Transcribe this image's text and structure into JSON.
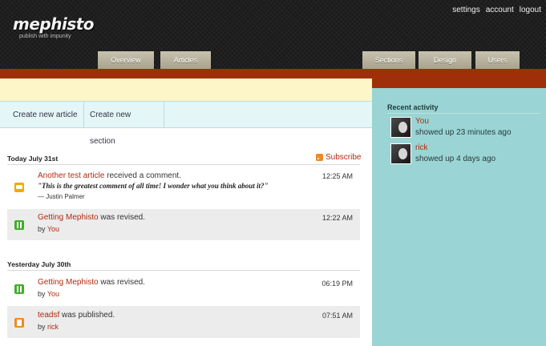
{
  "logo": {
    "name": "mephisto",
    "tagline": "publish with impunity"
  },
  "toplinks": [
    "settings",
    "account",
    "logout"
  ],
  "tabs": {
    "overview": "Overview",
    "articles": "Articles",
    "sections": "Sections",
    "design": "Design",
    "users": "Users"
  },
  "actions": {
    "new_article": "Create new article",
    "new_section": "Create new section"
  },
  "subscribe": "Subscribe",
  "days": [
    {
      "title": "Today July 31st",
      "entries": [
        {
          "icon": "comment-icon",
          "link": "Another test article",
          "text": " received a comment.",
          "quote": "\"This is the greatest comment of all time! I wonder what you think about it?\"",
          "author": "— Justin Palmer",
          "time": "12:25 AM"
        },
        {
          "icon": "revision-icon",
          "link": "Getting Mephisto",
          "text": " was revised.",
          "by": "by ",
          "by_user": "You",
          "time": "12:22 AM"
        }
      ]
    },
    {
      "title": "Yesterday July 30th",
      "entries": [
        {
          "icon": "revision-icon",
          "link": "Getting Mephisto",
          "text": " was revised.",
          "by": "by ",
          "by_user": "You",
          "time": "06:19 PM"
        },
        {
          "icon": "publish-icon",
          "link": "teadsf",
          "text": " was published.",
          "by": "by ",
          "by_user": "rick",
          "time": "07:51 AM"
        }
      ]
    }
  ],
  "recent": {
    "title": "Recent activity",
    "items": [
      {
        "who": "You",
        "when": "showed up 23 minutes ago"
      },
      {
        "who": "rick",
        "when": "showed up 4 days ago"
      }
    ]
  },
  "colors": {
    "link": "#b22a10",
    "sidebar": "#9ad4d4",
    "red_bar": "#9f2f08",
    "yellow_bar": "#fdf6c8"
  }
}
